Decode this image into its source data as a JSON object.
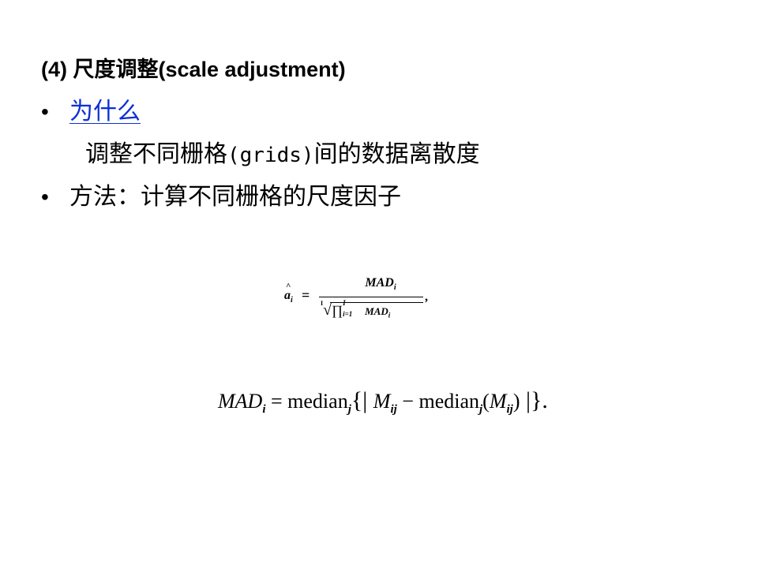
{
  "heading": {
    "number": "(4) ",
    "title_cn": "尺度调整",
    "title_en": "(scale adjustment)"
  },
  "bullets": [
    {
      "marker": "•",
      "text": "为什么",
      "is_link": true
    },
    {
      "marker": "•",
      "text": "方法：计算不同栅格的尺度因子",
      "is_link": false
    }
  ],
  "sub_line": {
    "before": "调整不同栅格",
    "mono": "(grids)",
    "after": "间的数据离散度"
  },
  "formula1": {
    "lhs_symbol": "a",
    "lhs_sub": "i",
    "hat": "^",
    "equals": "=",
    "numerator": "MAD",
    "numerator_sub": "i",
    "root_index": "I",
    "radical": "√",
    "product": "∏",
    "product_upper": "I",
    "product_lower": "i=1",
    "den_mad": "MAD",
    "den_mad_sub": "i",
    "trailing": ","
  },
  "formula2": {
    "lhs": "MAD",
    "lhs_sub": "i",
    "equals": " = ",
    "median1": "median",
    "median1_sub": "j",
    "open": "{| ",
    "m1": "M",
    "m1_sub": "ij",
    "minus": " − ",
    "median2": "median",
    "median2_sub": "j",
    "paren_open": "(",
    "m2": "M",
    "m2_sub": "ij",
    "paren_close": ")",
    "close": " |}."
  },
  "colors": {
    "text": "#000000",
    "link": "#0b2fd6",
    "background": "#ffffff"
  }
}
